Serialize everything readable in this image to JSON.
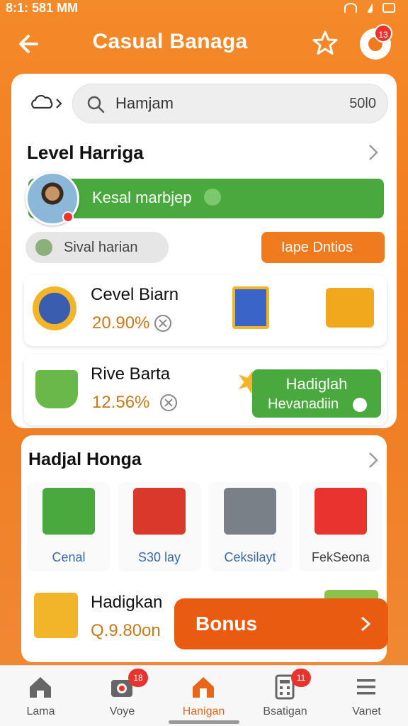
{
  "status_bar": {
    "time": "8:1: 581 MM"
  },
  "header": {
    "title": "Casual Banaga",
    "notification_count": "13"
  },
  "search": {
    "query": "Hamjam",
    "count": "50l0"
  },
  "level_section": {
    "title": "Level Harriga",
    "banner_text": "Kesal marbjep",
    "pill_gray": "Sival harian",
    "pill_orange": "Iape Dntios"
  },
  "rewards": [
    {
      "title": "Cevel Biarn",
      "value": "20.90%"
    },
    {
      "title": "Rive Barta",
      "value": "12.56%",
      "button_line1": "Hadiglah",
      "button_line2": "Hevanadiin"
    }
  ],
  "gift_section": {
    "title": "Hadjal Honga",
    "items": [
      {
        "label": "Cenal",
        "color": "#4aa93e"
      },
      {
        "label": "S30 lay",
        "color": "#d9382b"
      },
      {
        "label": "Ceksilayt",
        "color": "#7a8088"
      },
      {
        "label": "FekSeona",
        "color": "#e8332f"
      }
    ]
  },
  "bonus_row": {
    "title": "Hadigkan",
    "value": "Q.9.80on",
    "bonus_label": "Bonus"
  },
  "bottom_nav": [
    {
      "label": "Lama",
      "icon": "home-icon",
      "badge": ""
    },
    {
      "label": "Voye",
      "icon": "camera-icon",
      "badge": "18"
    },
    {
      "label": "Hanigan",
      "icon": "home-icon",
      "badge": ""
    },
    {
      "label": "Bsatigan",
      "icon": "calculator-icon",
      "badge": "11"
    },
    {
      "label": "Vanet",
      "icon": "menu-icon",
      "badge": ""
    }
  ],
  "colors": {
    "accent": "#f07a1e",
    "green": "#4aa93e",
    "badge": "#e8332f",
    "bonus": "#ea5b12"
  }
}
